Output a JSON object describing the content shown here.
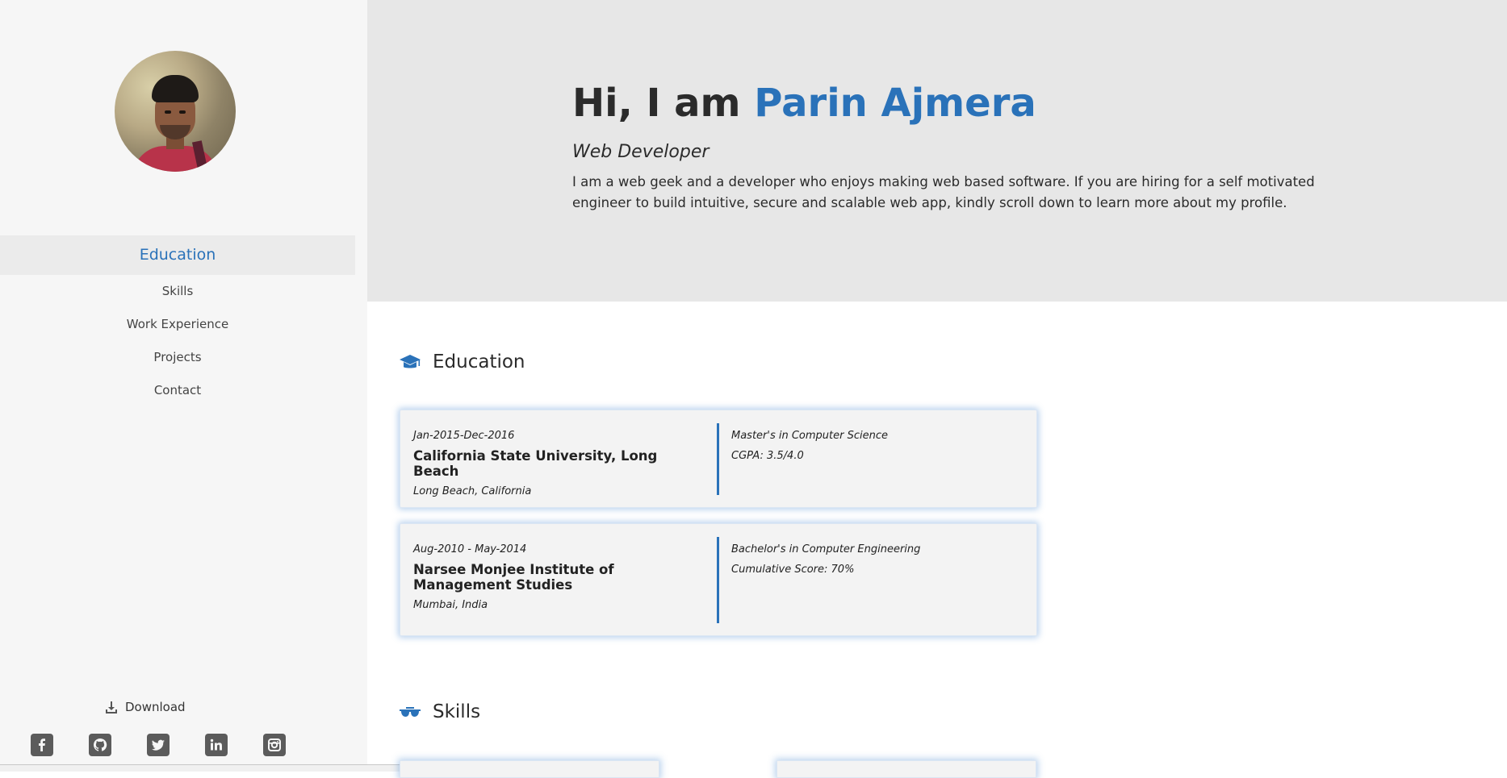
{
  "sidebar": {
    "nav": [
      {
        "label": "Education",
        "active": true
      },
      {
        "label": "Skills",
        "active": false
      },
      {
        "label": "Work Experience",
        "active": false
      },
      {
        "label": "Projects",
        "active": false
      },
      {
        "label": "Contact",
        "active": false
      }
    ],
    "download_label": "Download",
    "socials": [
      "facebook-icon",
      "github-icon",
      "twitter-icon",
      "linkedin-icon",
      "instagram-icon"
    ]
  },
  "hero": {
    "greeting": "Hi, I am ",
    "name": "Parin Ajmera",
    "role": "Web Developer",
    "bio": "I am a web geek and a developer who enjoys making web based software. If you are hiring for a self motivated engineer to build intuitive, secure and scalable web app, kindly scroll down to learn more about my profile."
  },
  "education": {
    "title": "Education",
    "items": [
      {
        "dates": "Jan-2015-Dec-2016",
        "school": "California State University, Long Beach",
        "location": "Long Beach, California",
        "degree": "Master's in Computer Science",
        "score": "CGPA: 3.5/4.0"
      },
      {
        "dates": "Aug-2010 - May-2014",
        "school": "Narsee Monjee Institute of Management Studies",
        "location": "Mumbai, India",
        "degree": "Bachelor's in Computer Engineering",
        "score": "Cumulative Score: 70%"
      }
    ]
  },
  "skills": {
    "title": "Skills"
  },
  "colors": {
    "accent": "#2a72b9",
    "sidebar_bg": "#f6f6f6",
    "hero_bg": "#e7e7e7"
  }
}
